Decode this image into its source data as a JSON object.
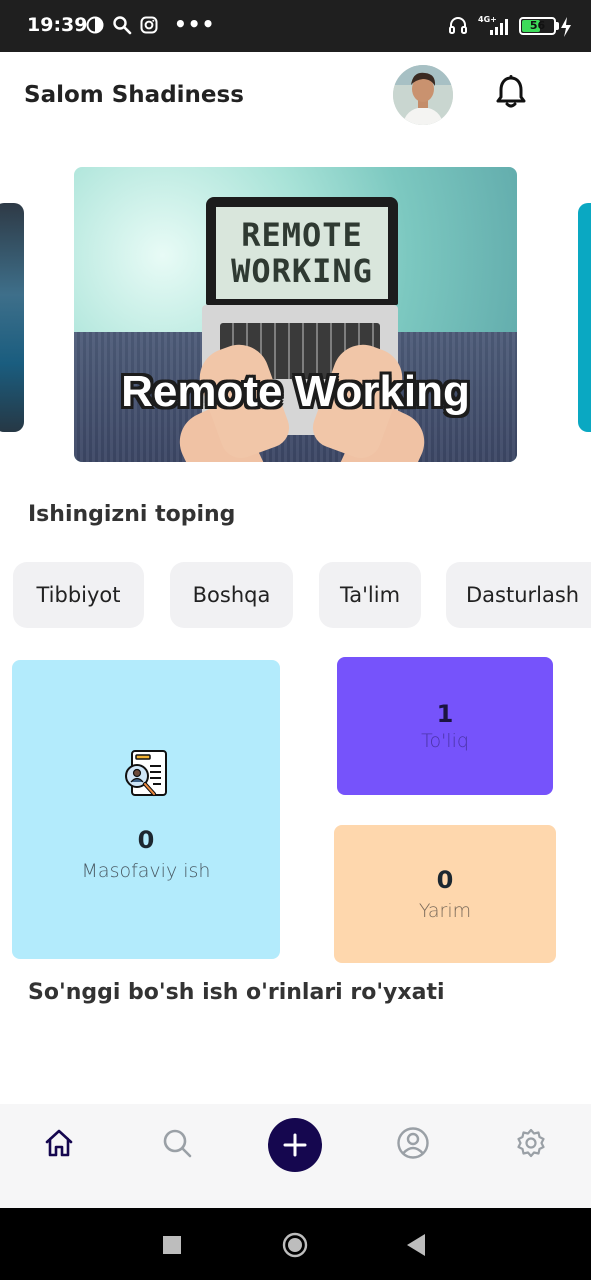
{
  "status_bar": {
    "time": "19:39",
    "more": "•••",
    "network": "4G+",
    "battery": "56"
  },
  "header": {
    "greeting": "Salom Shadiness"
  },
  "banner": {
    "screen_line1": "REMOTE",
    "screen_line2": "WORKING",
    "caption": "Remote Working"
  },
  "categories_section": {
    "title": "Ishingizni toping",
    "chips": [
      "Tibbiyot",
      "Boshqa",
      "Ta'lim",
      "Dasturlash"
    ]
  },
  "stats": {
    "remote": {
      "count": "0",
      "label": "Masofaviy ish",
      "color": "#b3ebfc"
    },
    "full": {
      "count": "1",
      "label": "To'liq",
      "color": "#7653fb"
    },
    "part": {
      "count": "0",
      "label": "Yarim",
      "color": "#fed7ad"
    }
  },
  "recent_section": {
    "title": "So'nggi bo'sh ish o'rinlari ro'yxati"
  },
  "bottom_nav": {
    "items": [
      "home-icon",
      "search-icon",
      "add-icon",
      "profile-icon",
      "settings-icon"
    ],
    "active_color": "#15074f"
  }
}
